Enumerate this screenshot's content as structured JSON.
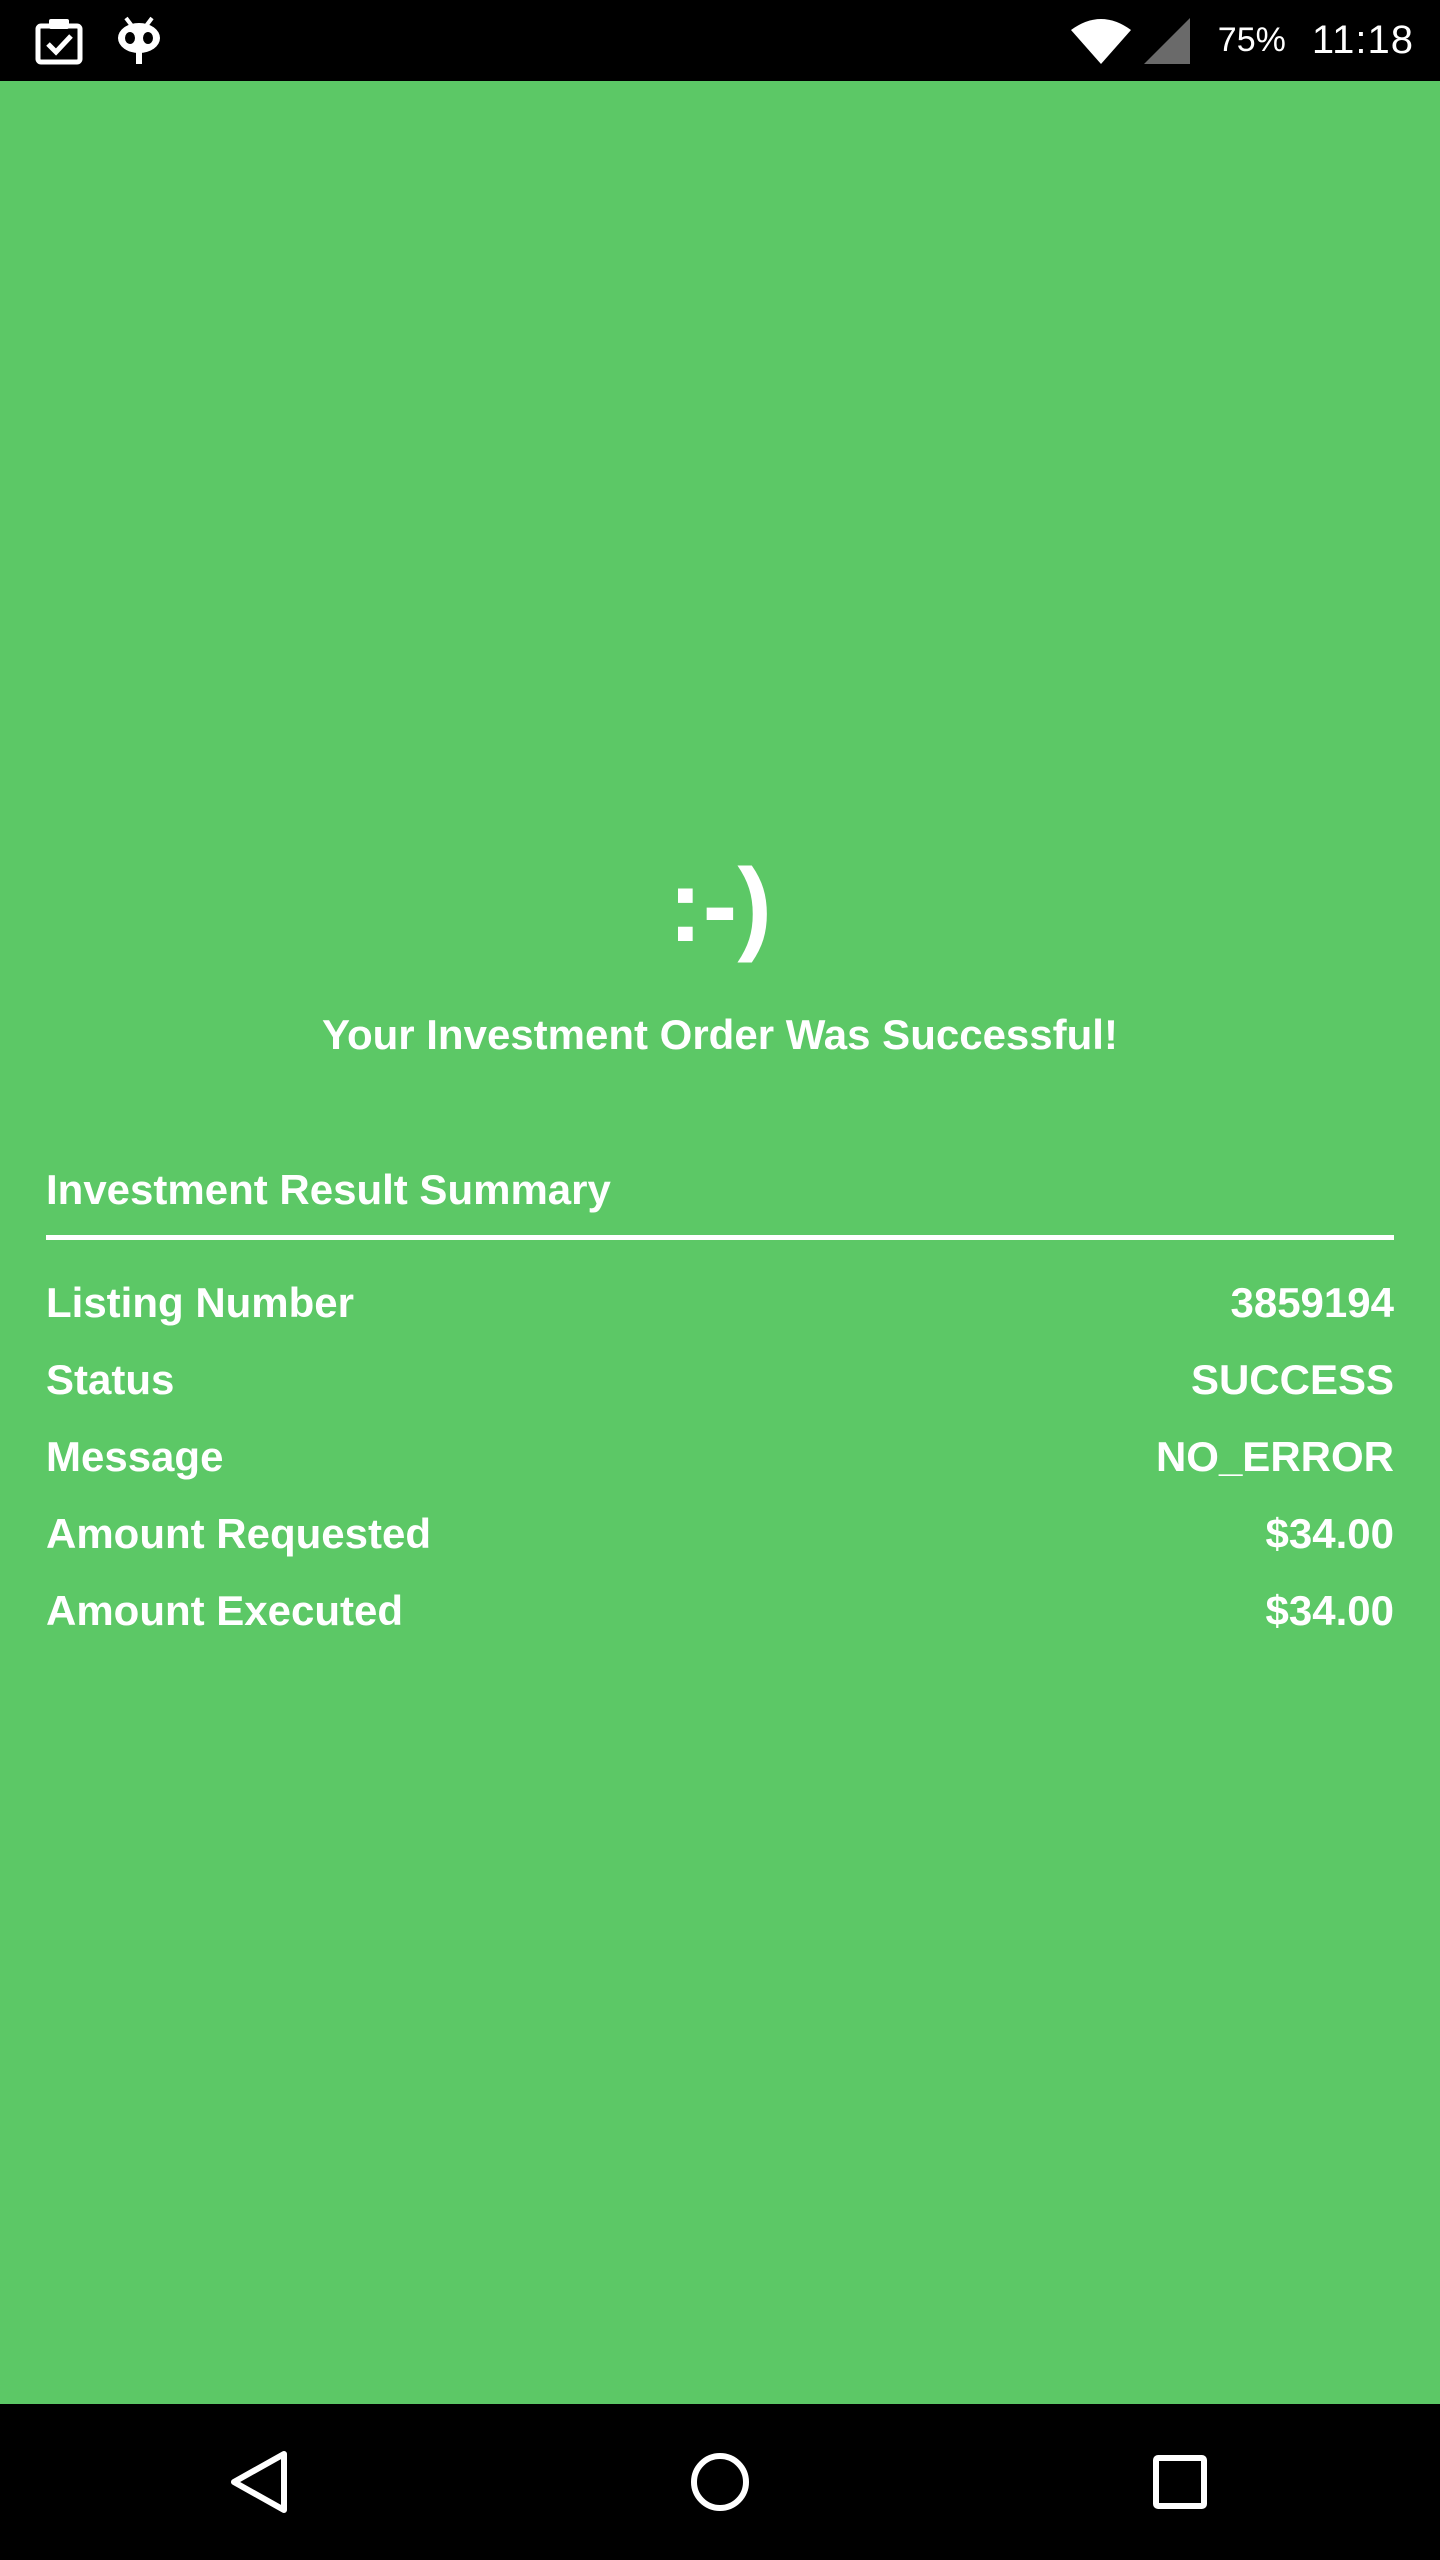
{
  "status_bar": {
    "battery_text": "75%",
    "time": "11:18",
    "left_icons": [
      "clipboard-check-icon",
      "robot-icon"
    ],
    "right_icons": [
      "wifi-icon",
      "cellular-signal-icon"
    ]
  },
  "result": {
    "smiley": ":-)",
    "message": "Your Investment Order Was Successful!"
  },
  "summary": {
    "title": "Investment Result Summary",
    "rows": [
      {
        "label": "Listing Number",
        "value": "3859194"
      },
      {
        "label": "Status",
        "value": "SUCCESS"
      },
      {
        "label": "Message",
        "value": "NO_ERROR"
      },
      {
        "label": "Amount Requested",
        "value": "$34.00"
      },
      {
        "label": "Amount Executed",
        "value": "$34.00"
      }
    ]
  },
  "nav_bar": {
    "buttons": [
      "back-icon",
      "home-icon",
      "recents-icon"
    ]
  },
  "colors": {
    "background": "#5cc866",
    "text": "#ffffff",
    "system_bars": "#000000"
  }
}
